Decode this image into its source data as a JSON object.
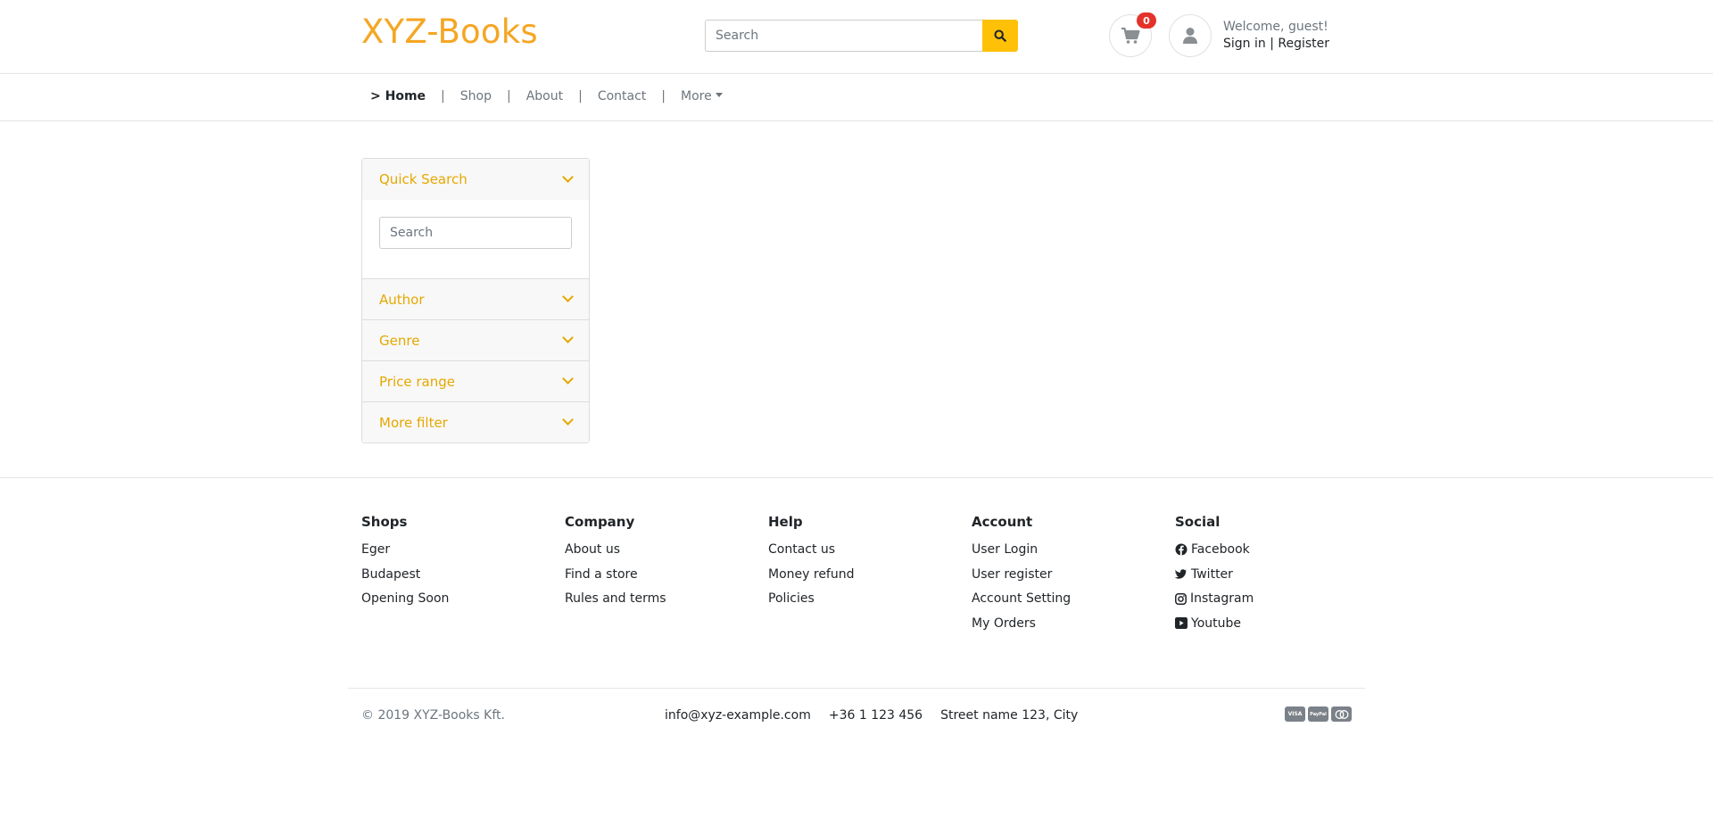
{
  "header": {
    "logo": "XYZ-Books",
    "search_placeholder": "Search",
    "cart_count": "0",
    "welcome": "Welcome, guest!",
    "sign_in": "Sign in",
    "separator": "|",
    "register": "Register"
  },
  "nav": {
    "items": [
      {
        "label": "> Home",
        "active": true
      },
      {
        "label": "Shop"
      },
      {
        "label": "About"
      },
      {
        "label": "Contact"
      },
      {
        "label": "More"
      }
    ],
    "separator": "|"
  },
  "filters": {
    "quick_search": {
      "label": "Quick Search",
      "placeholder": "Search"
    },
    "sections": [
      "Author",
      "Genre",
      "Price range",
      "More filter"
    ]
  },
  "footer": {
    "columns": [
      {
        "title": "Shops",
        "items": [
          "Eger",
          "Budapest",
          "Opening Soon"
        ]
      },
      {
        "title": "Company",
        "items": [
          "About us",
          "Find a store",
          "Rules and terms"
        ]
      },
      {
        "title": "Help",
        "items": [
          "Contact us",
          "Money refund",
          "Policies"
        ]
      },
      {
        "title": "Account",
        "items": [
          "User Login",
          "User register",
          "Account Setting",
          "My Orders"
        ]
      },
      {
        "title": "Social",
        "items": [
          "Facebook",
          "Twitter",
          "Instagram",
          "Youtube"
        ]
      }
    ],
    "copyright": "© 2019 XYZ-Books Kft.",
    "email": "info@xyz-example.com",
    "phone": "+36 1 123 456",
    "address": "Street name 123, City",
    "payments": [
      "VISA",
      "PayPal",
      "MC"
    ]
  },
  "colors": {
    "brand": "#f5a623",
    "accent": "#ffc107",
    "filter_text": "#e5a800",
    "badge": "#e4322b"
  }
}
